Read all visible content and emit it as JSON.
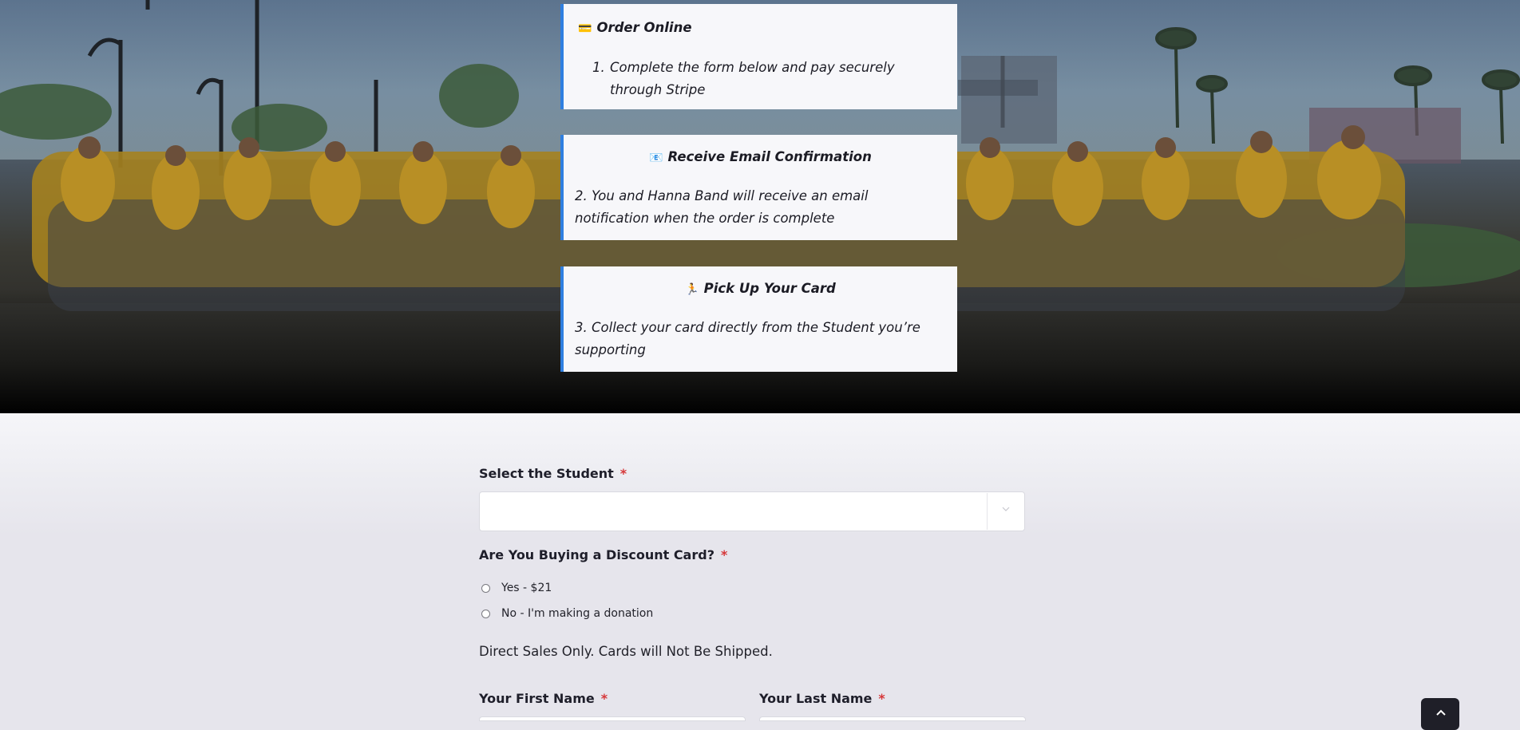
{
  "steps": [
    {
      "icon": "credit-card-icon",
      "icon_glyph": "💳",
      "title": "Order Online",
      "number": "1.",
      "text": "Complete the form below and pay securely through Stripe"
    },
    {
      "icon": "email-icon",
      "icon_glyph": "📧",
      "title": "Receive Email Confirmation",
      "number": "2.",
      "text": "You and Hanna Band will receive an email notification when the order is complete"
    },
    {
      "icon": "runner-icon",
      "icon_glyph": "🏃",
      "title": "Pick Up Your Card",
      "number": "3.",
      "text": "Collect your card directly from the Student you’re supporting"
    }
  ],
  "form": {
    "student_label": "Select the Student",
    "required_mark": "*",
    "student_value": "",
    "discount_label": "Are You Buying a Discount Card?",
    "options": [
      "Yes - $21",
      "No - I'm making a donation"
    ],
    "note": "Direct Sales Only. Cards will Not Be Shipped.",
    "first_name_label": "Your First Name",
    "last_name_label": "Your Last Name"
  },
  "colors": {
    "accent": "#2f7fe0",
    "required": "#d63638",
    "page_bg": "#e6e5ec",
    "card_bg": "#f7f7fa"
  },
  "icons": {
    "select_arrow": "chevron-down-icon",
    "back_to_top": "chevron-up-icon"
  }
}
